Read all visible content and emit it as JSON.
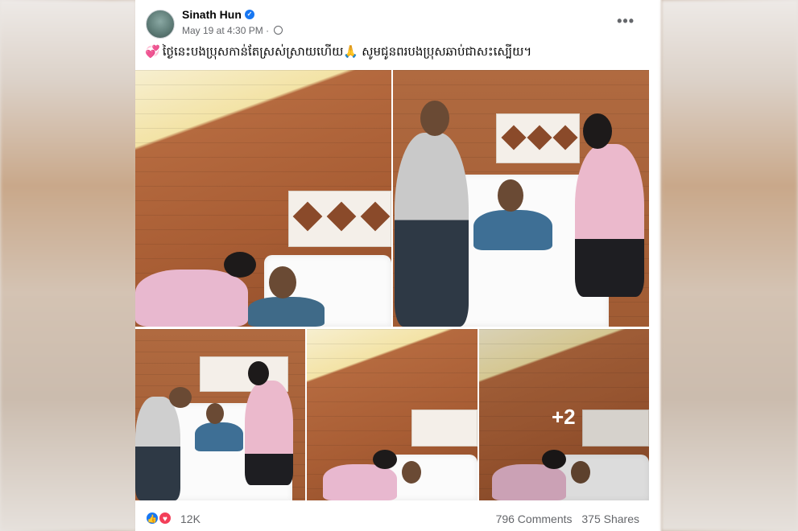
{
  "post": {
    "author": "Sinath Hun",
    "verified_mark": "✓",
    "timestamp": "May 19 at 4:30 PM",
    "separator": "·",
    "more_label": "•••",
    "caption_emoji": "💞",
    "caption_text": "ថ្ងៃនេះបងប្រុសកាន់តែស្រស់ស្រាយហើយ🙏 សូមជូនពរបងប្រុសឆាប់ជាសះស្បើយ។"
  },
  "photos": {
    "more_overlay": "+2"
  },
  "footer": {
    "like_icon": "👍",
    "love_icon": "♥",
    "reaction_count": "12K",
    "comments": "796 Comments",
    "shares": "375 Shares"
  },
  "colors": {
    "facebook_blue": "#1877f2",
    "love_red": "#f33e58",
    "wood": "#a85d34"
  }
}
